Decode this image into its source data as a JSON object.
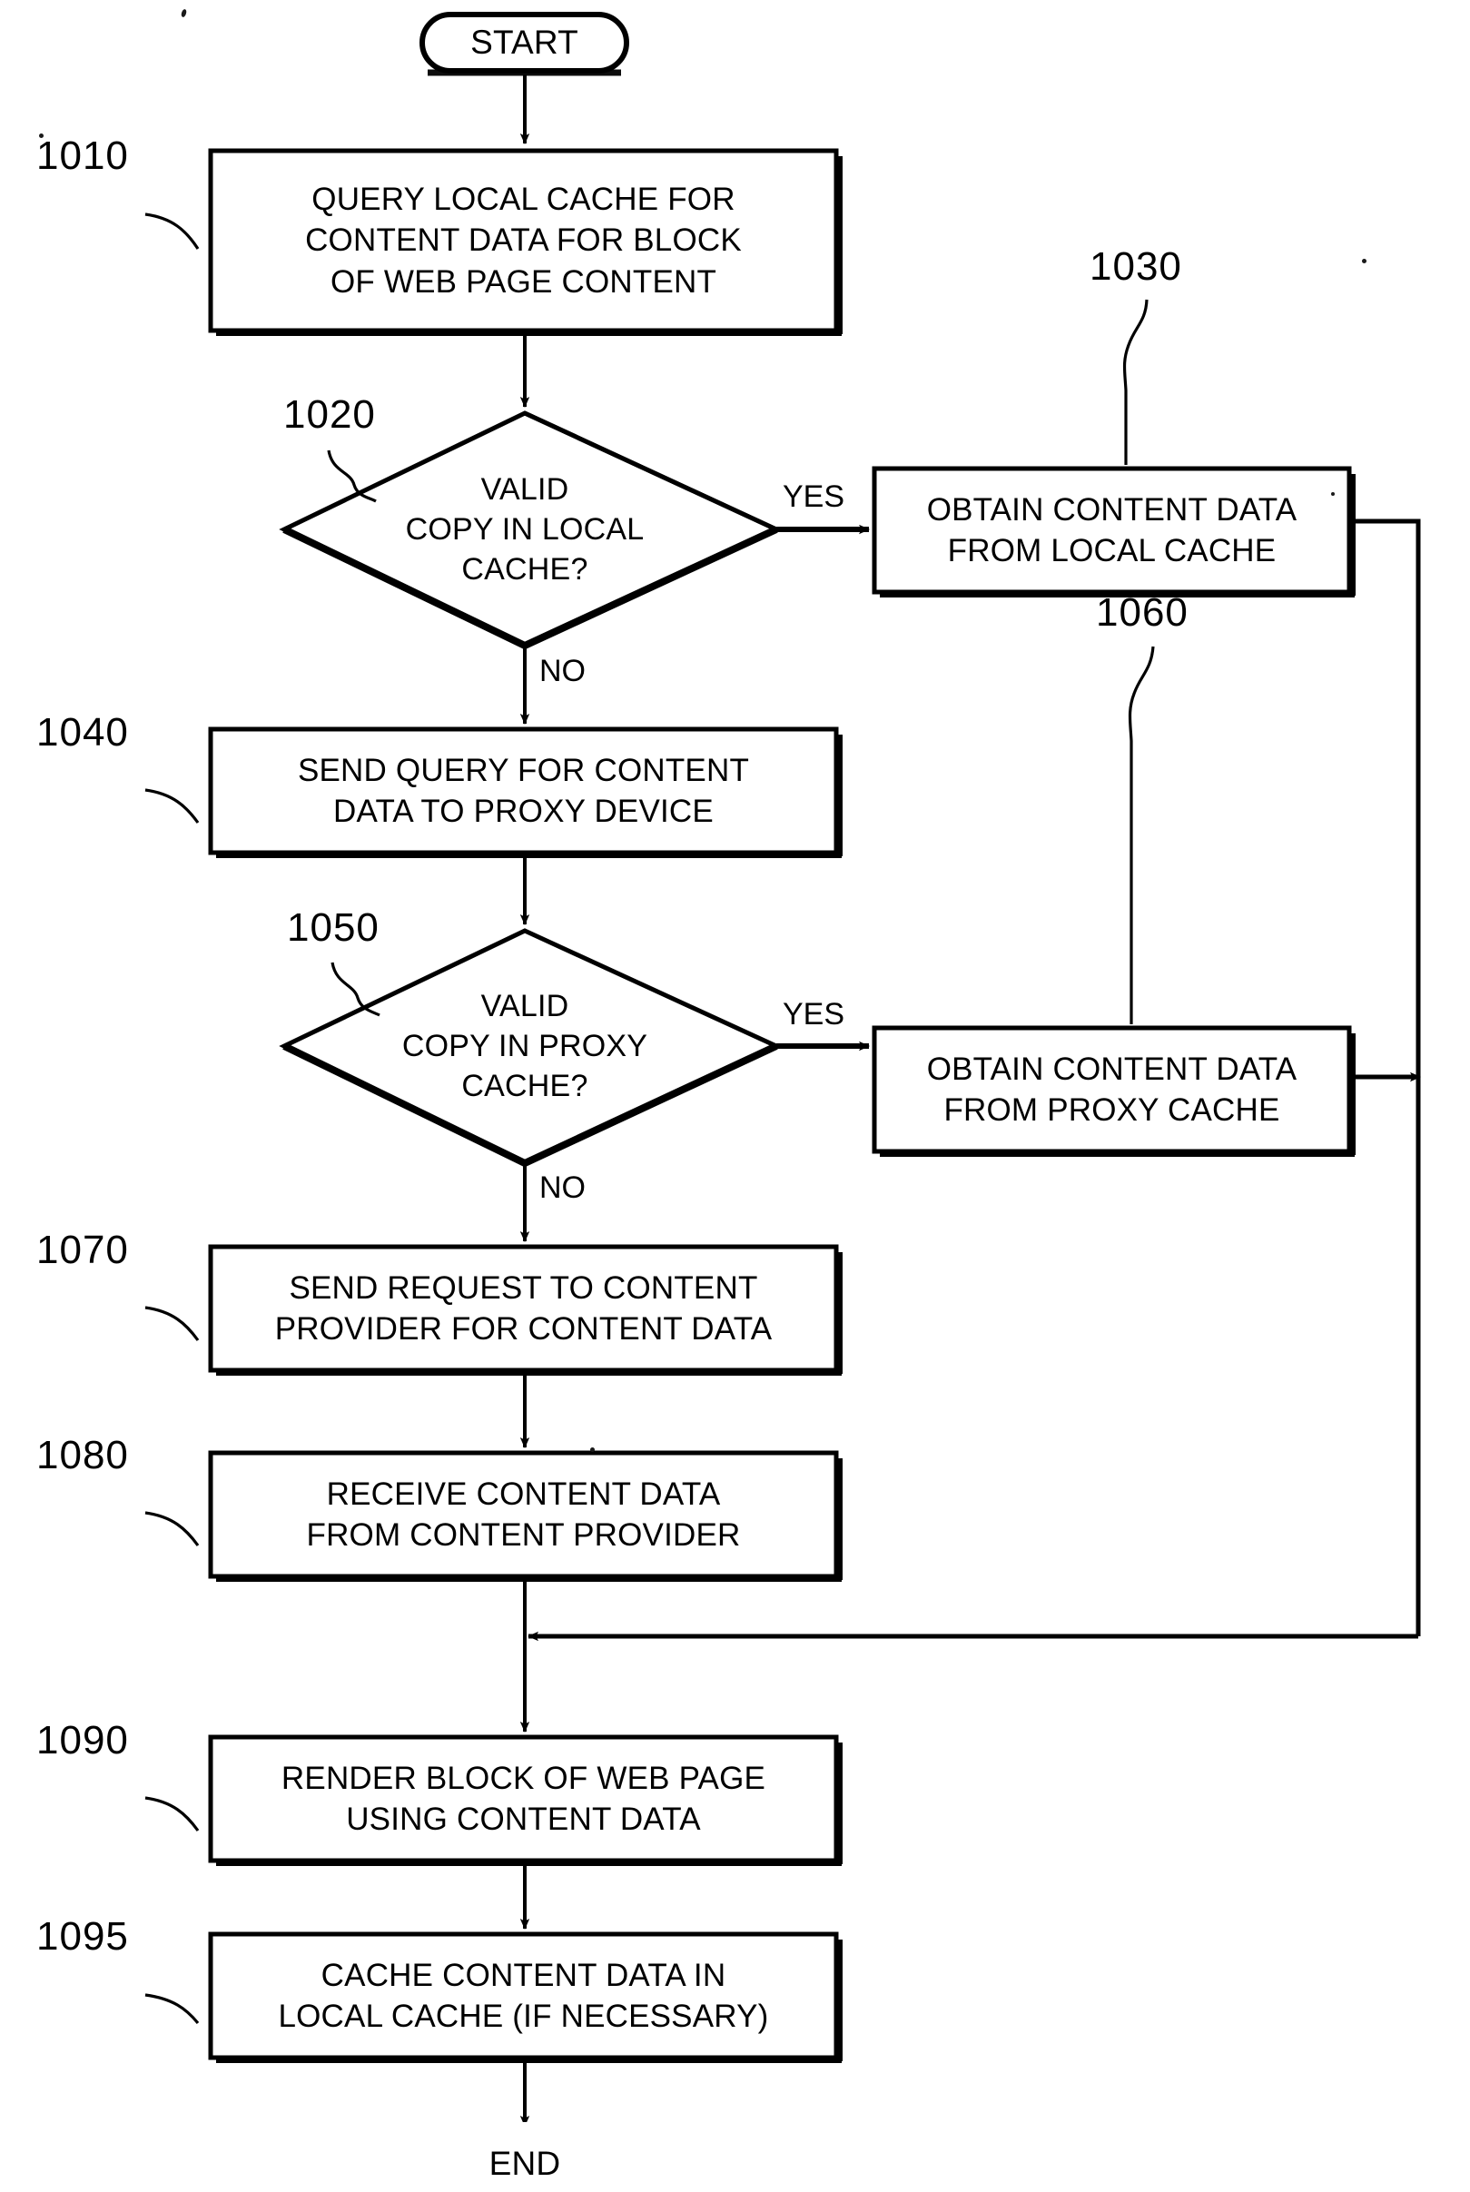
{
  "figure": {
    "type": "flowchart",
    "title": "",
    "nodes": [
      {
        "id": "start",
        "shape": "terminator",
        "lines": [
          "START"
        ]
      },
      {
        "id": "1010",
        "shape": "process",
        "ref": "1010",
        "lines": [
          "QUERY LOCAL CACHE FOR",
          "CONTENT DATA FOR BLOCK",
          "OF WEB PAGE CONTENT"
        ]
      },
      {
        "id": "1020",
        "shape": "decision",
        "ref": "1020",
        "lines": [
          "VALID",
          "COPY IN LOCAL",
          "CACHE?"
        ]
      },
      {
        "id": "1030",
        "shape": "process",
        "ref": "1030",
        "lines": [
          "OBTAIN CONTENT DATA",
          "FROM LOCAL CACHE"
        ]
      },
      {
        "id": "1040",
        "shape": "process",
        "ref": "1040",
        "lines": [
          "SEND QUERY FOR CONTENT",
          "DATA TO PROXY DEVICE"
        ]
      },
      {
        "id": "1050",
        "shape": "decision",
        "ref": "1050",
        "lines": [
          "VALID",
          "COPY IN PROXY",
          "CACHE?"
        ]
      },
      {
        "id": "1060",
        "shape": "process",
        "ref": "1060",
        "lines": [
          "OBTAIN CONTENT DATA",
          "FROM PROXY CACHE"
        ]
      },
      {
        "id": "1070",
        "shape": "process",
        "ref": "1070",
        "lines": [
          "SEND REQUEST TO CONTENT",
          "PROVIDER FOR CONTENT DATA"
        ]
      },
      {
        "id": "1080",
        "shape": "process",
        "ref": "1080",
        "lines": [
          "RECEIVE CONTENT DATA",
          "FROM CONTENT PROVIDER"
        ]
      },
      {
        "id": "1090",
        "shape": "process",
        "ref": "1090",
        "lines": [
          "RENDER BLOCK OF WEB PAGE",
          "USING CONTENT DATA"
        ]
      },
      {
        "id": "1095",
        "shape": "process",
        "ref": "1095",
        "lines": [
          "CACHE CONTENT DATA IN",
          "LOCAL CACHE (IF NECESSARY)"
        ]
      },
      {
        "id": "end",
        "shape": "terminator",
        "lines": [
          "END"
        ]
      }
    ],
    "edge_labels": {
      "yes_local": "YES",
      "no_local": "NO",
      "yes_proxy": "YES",
      "no_proxy": "NO"
    },
    "reference_numerals": {
      "n1010": "1010",
      "n1020": "1020",
      "n1030": "1030",
      "n1040": "1040",
      "n1050": "1050",
      "n1060": "1060",
      "n1070": "1070",
      "n1080": "1080",
      "n1090": "1090",
      "n1095": "1095"
    },
    "colors": {
      "ink": "#000000",
      "paper": "#ffffff"
    }
  }
}
